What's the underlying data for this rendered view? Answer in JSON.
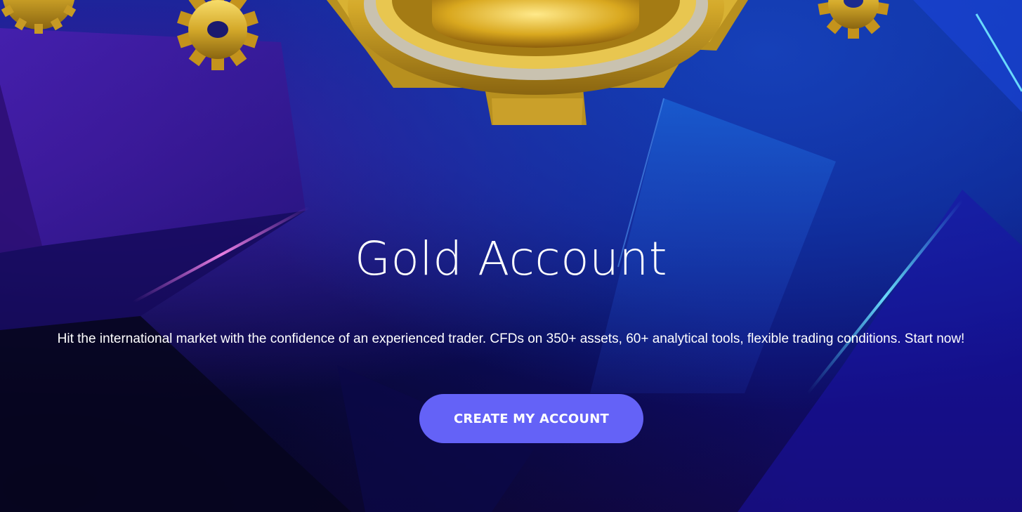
{
  "hero": {
    "title": "Gold Account",
    "description": "Hit the international market with the confidence of an experienced trader. CFDs on 350+ assets, 60+ analytical tools, flexible trading conditions. Start now!",
    "cta_label": "CREATE MY ACCOUNT"
  },
  "colors": {
    "cta_background": "#6462f7",
    "gold": "#d9b233",
    "background_blue": "#0b1f86",
    "text": "#ffffff"
  },
  "decorations": [
    "gold-medal-icon",
    "gold-gear-icon",
    "gold-gear-icon",
    "gold-gear-icon"
  ]
}
